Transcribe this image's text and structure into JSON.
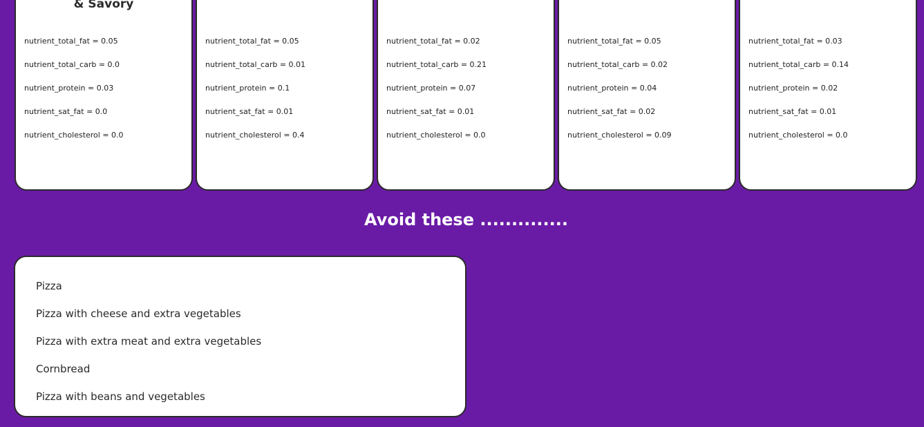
{
  "cards": [
    {
      "title": "Breakfast Sausage, Sweet\n& Savory",
      "nutrients": [
        "nutrient_total_fat = 0.05",
        "nutrient_total_carb = 0.0",
        "nutrient_protein = 0.03",
        "nutrient_sat_fat = 0.0",
        "nutrient_cholesterol = 0.0"
      ]
    },
    {
      "title": "",
      "nutrients": [
        "nutrient_total_fat = 0.05",
        "nutrient_total_carb = 0.01",
        "nutrient_protein = 0.1",
        "nutrient_sat_fat = 0.01",
        "nutrient_cholesterol = 0.4"
      ]
    },
    {
      "title": "",
      "nutrients": [
        "nutrient_total_fat = 0.02",
        "nutrient_total_carb = 0.21",
        "nutrient_protein = 0.07",
        "nutrient_sat_fat = 0.01",
        "nutrient_cholesterol = 0.0"
      ]
    },
    {
      "title": "",
      "nutrients": [
        "nutrient_total_fat = 0.05",
        "nutrient_total_carb = 0.02",
        "nutrient_protein = 0.04",
        "nutrient_sat_fat = 0.02",
        "nutrient_cholesterol = 0.09"
      ]
    },
    {
      "title": "",
      "nutrients": [
        "nutrient_total_fat = 0.03",
        "nutrient_total_carb = 0.14",
        "nutrient_protein = 0.02",
        "nutrient_sat_fat = 0.01",
        "nutrient_cholesterol = 0.0"
      ]
    }
  ],
  "avoid": {
    "heading": "Avoid these ..............",
    "items": [
      "Pizza",
      "Pizza with cheese and extra vegetables",
      "Pizza with extra meat and extra vegetables",
      "Cornbread",
      "Pizza with beans and vegetables"
    ]
  },
  "colors": {
    "background": "#6a1ba6",
    "card": "#ffffff",
    "border": "#2a2a2a"
  }
}
